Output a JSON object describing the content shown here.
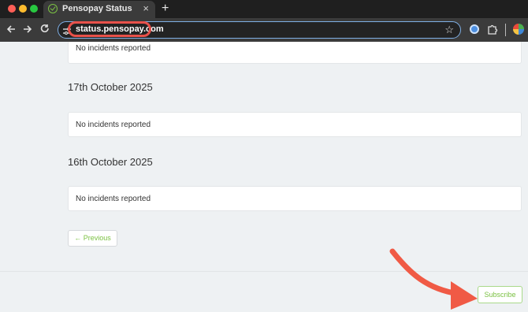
{
  "browser": {
    "tab": {
      "title": "Pensopay Status",
      "close_glyph": "×"
    },
    "new_tab_glyph": "+",
    "address_bar": {
      "url": "status.pensopay.com"
    },
    "accent_annotation_color": "#e8514a"
  },
  "page": {
    "top_incident_text": "No incidents reported",
    "days": [
      {
        "date": "17th October 2025",
        "incident_text": "No incidents reported"
      },
      {
        "date": "16th October 2025",
        "incident_text": "No incidents reported"
      }
    ],
    "previous_label": "← Previous",
    "subscribe_label": "Subscribe"
  },
  "colors": {
    "brand_green": "#7bc143",
    "page_background": "#eef1f3"
  }
}
